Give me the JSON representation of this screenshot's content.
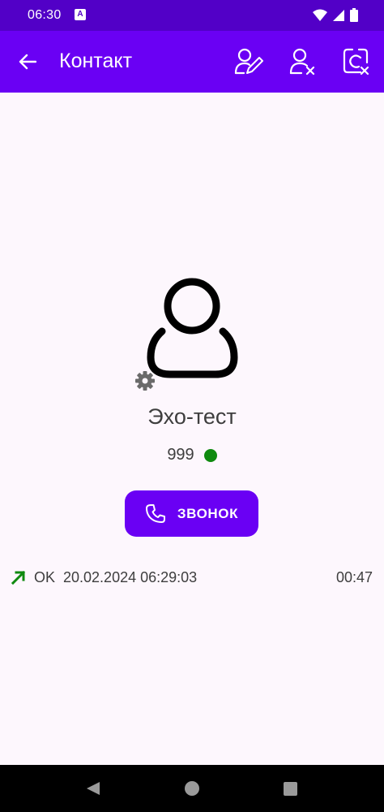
{
  "status_bar": {
    "time": "06:30",
    "notification_letter": "A",
    "icons": [
      "wifi-icon",
      "signal-icon",
      "battery-icon"
    ]
  },
  "app_bar": {
    "title": "Контакт",
    "back_icon": "arrow-back-icon",
    "actions": [
      "edit-contact-icon",
      "remove-contact-icon",
      "block-contact-icon"
    ]
  },
  "contact": {
    "name": "Эхо-тест",
    "number": "999",
    "presence_color": "#0f8a0f",
    "avatar_icon": "person-outline-icon",
    "settings_icon": "gear-icon"
  },
  "call_button": {
    "label": "ЗВОНОК",
    "icon": "phone-icon"
  },
  "history": [
    {
      "direction_icon": "outgoing-call-arrow-icon",
      "status": "OK",
      "datetime": "20.02.2024 06:29:03",
      "duration": "00:47"
    }
  ],
  "colors": {
    "status_bar": "#5200c7",
    "app_bar": "#6a00f4",
    "accent": "#6a00f4",
    "background": "#fdf7fd",
    "outgoing_arrow": "#0f8a0f"
  }
}
